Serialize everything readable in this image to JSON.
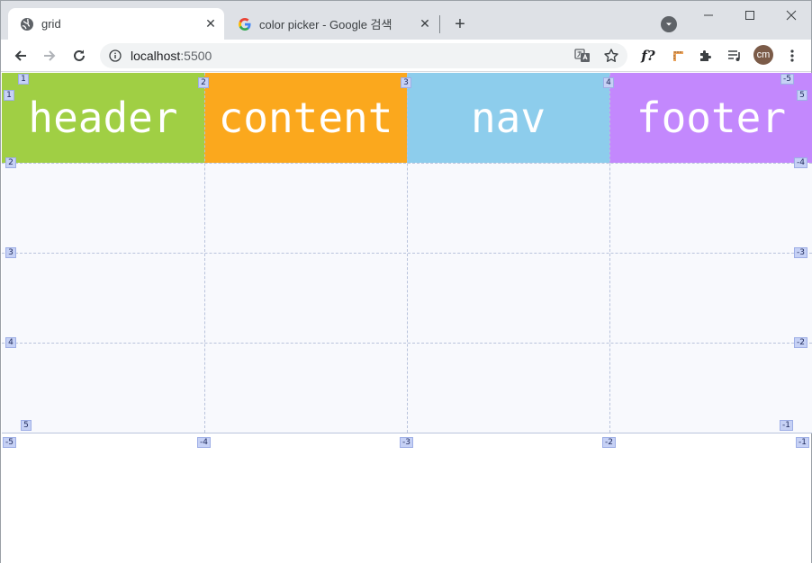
{
  "browser": {
    "tabs": [
      {
        "title": "grid",
        "active": true,
        "favicon": "globe-icon"
      },
      {
        "title": "color picker - Google 검색",
        "active": false,
        "favicon": "google-g-icon"
      }
    ],
    "new_tab_label": "+",
    "window_controls": [
      "minimize-icon",
      "maximize-icon",
      "close-icon"
    ],
    "address": {
      "host": "localhost",
      "port": ":5500"
    },
    "profile_initials": "cm",
    "extension_label": "f?"
  },
  "page": {
    "grid_items": [
      {
        "label": "header",
        "color": "#a0cf44"
      },
      {
        "label": "content",
        "color": "#fba81d"
      },
      {
        "label": "nav",
        "color": "#8dcdec"
      },
      {
        "label": "footer",
        "color": "#c388fd"
      }
    ],
    "grid_overlay": {
      "column_numbers_top": [
        "1",
        "2",
        "3",
        "4",
        "-5"
      ],
      "column_numbers_bottom": [
        "-5",
        "-4",
        "-3",
        "-2",
        "-1"
      ],
      "row_numbers_left": [
        "1",
        "2",
        "3",
        "4",
        "5"
      ],
      "row_numbers_right": [
        "5",
        "-4",
        "-3",
        "-2",
        "-1"
      ],
      "line_color": "#b9c3dc",
      "badge_color": "#c6d1f5"
    }
  }
}
